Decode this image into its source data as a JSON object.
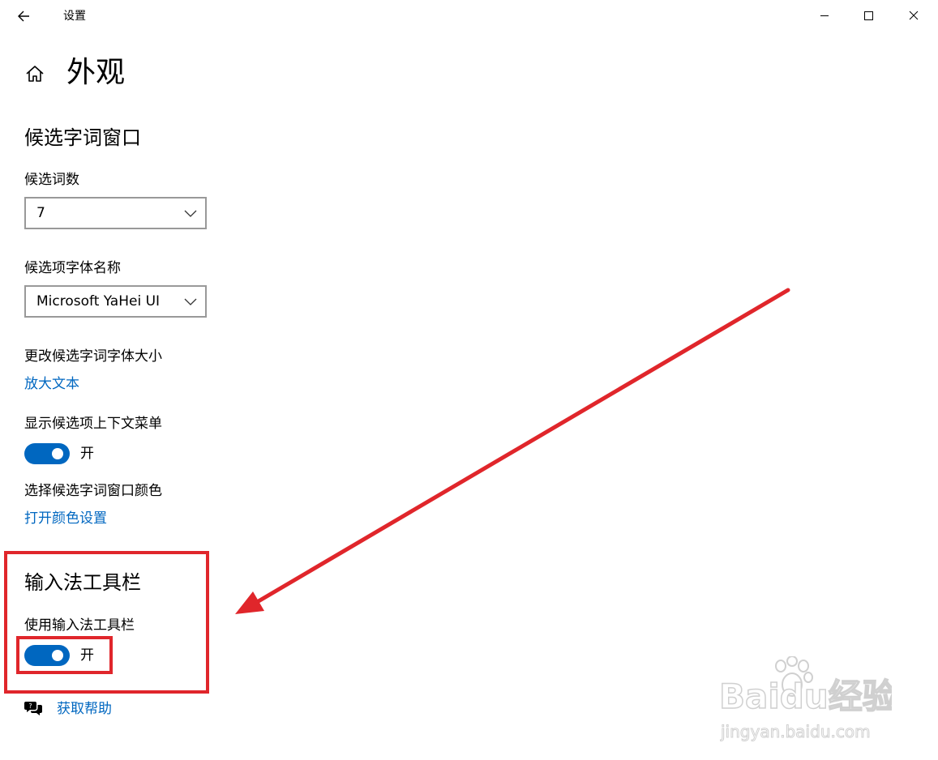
{
  "titlebar": {
    "title": "设置",
    "back_icon": "arrow-left-icon",
    "minimize_icon": "minimize-icon",
    "maximize_icon": "maximize-icon",
    "close_icon": "close-icon"
  },
  "header": {
    "home_icon": "home-icon",
    "title": "外观"
  },
  "candidate_window": {
    "heading": "候选字词窗口",
    "count": {
      "label": "候选词数",
      "value": "7"
    },
    "font_name": {
      "label": "候选项字体名称",
      "value": "Microsoft YaHei UI"
    },
    "font_size": {
      "label": "更改候选字词字体大小",
      "link": "放大文本"
    },
    "context_menu": {
      "label": "显示候选项上下文菜单",
      "state": "开",
      "on": true
    },
    "color": {
      "label": "选择候选字词窗口颜色",
      "link": "打开颜色设置"
    }
  },
  "ime_toolbar": {
    "heading": "输入法工具栏",
    "label": "使用输入法工具栏",
    "state": "开",
    "on": true
  },
  "help": {
    "icon": "help-chat-icon",
    "link": "获取帮助"
  },
  "annotation_color": "#e0262b",
  "accent_color": "#0067c0",
  "watermark": {
    "logo_text": "Baidu经验",
    "url_text": "jingyan.baidu.com"
  }
}
